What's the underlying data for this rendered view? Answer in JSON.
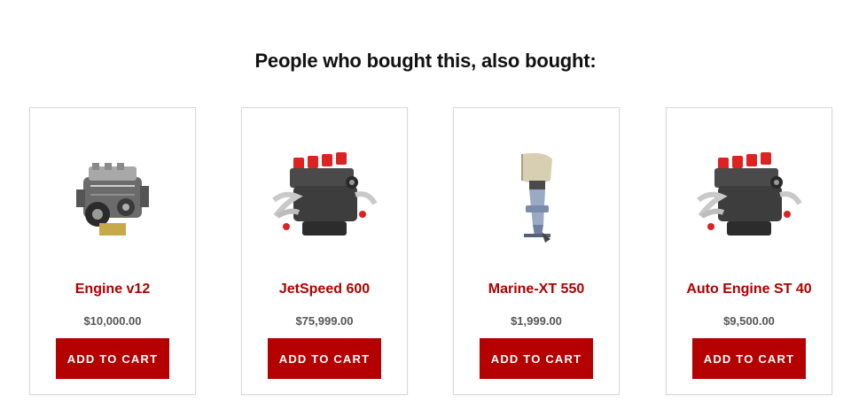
{
  "section": {
    "title": "People who bought this, also bought:"
  },
  "products": [
    {
      "name": "Engine v12",
      "price": "$10,000.00",
      "button_label": "ADD TO CART",
      "image_icon": "car-engine-icon"
    },
    {
      "name": "JetSpeed 600",
      "price": "$75,999.00",
      "button_label": "ADD TO CART",
      "image_icon": "v8-engine-icon"
    },
    {
      "name": "Marine-XT 550",
      "price": "$1,999.00",
      "button_label": "ADD TO CART",
      "image_icon": "outboard-motor-icon"
    },
    {
      "name": "Auto Engine ST 40",
      "price": "$9,500.00",
      "button_label": "ADD TO CART",
      "image_icon": "v8-engine-icon"
    }
  ],
  "colors": {
    "accent": "#b50000",
    "product_name": "#b00000",
    "price": "#555555",
    "card_border": "#d9d9d9"
  }
}
